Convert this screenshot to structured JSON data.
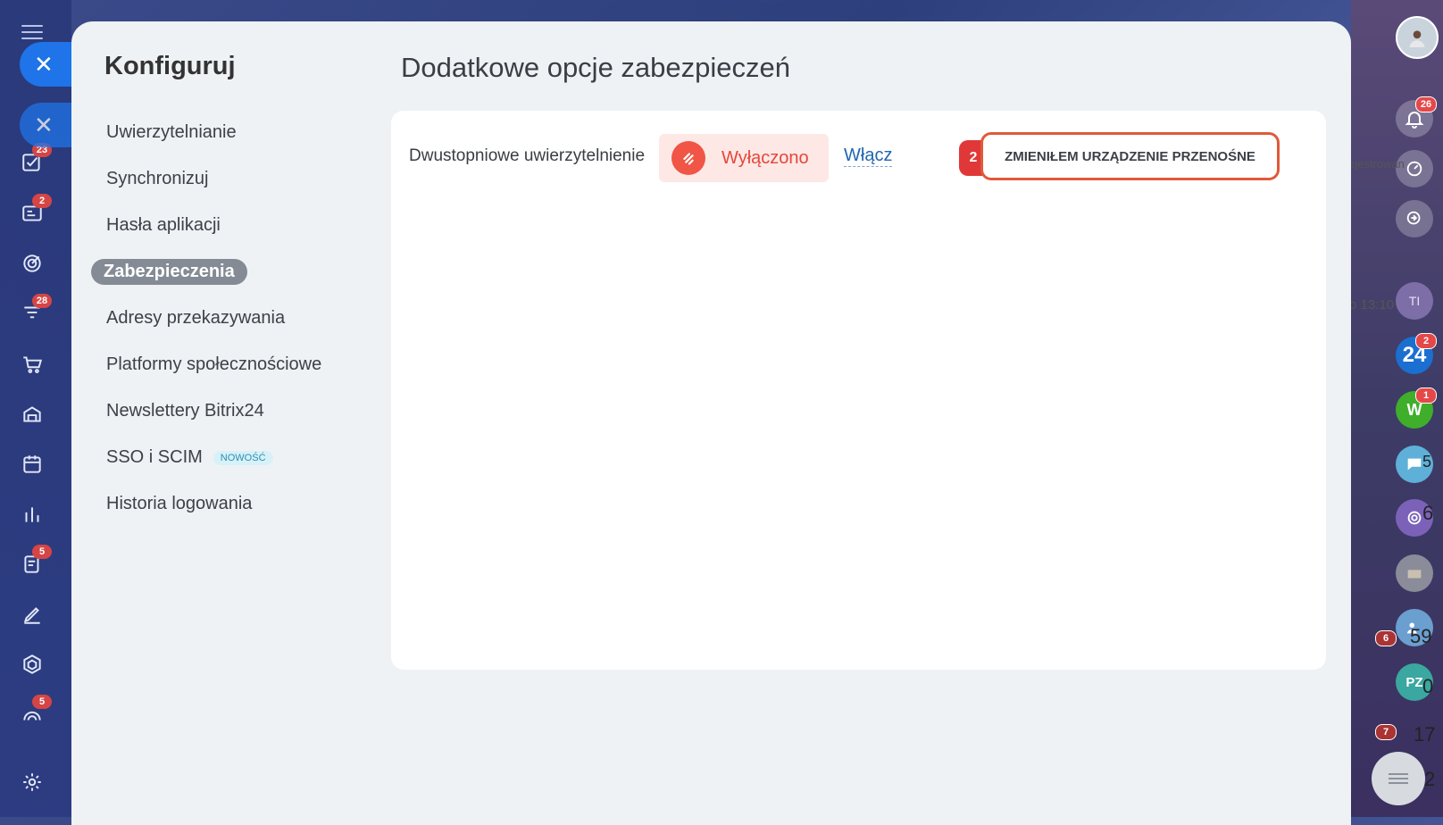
{
  "colors": {
    "accent": "#1e74e8",
    "active_nav": "#858b94",
    "danger": "#f05545",
    "highlight_border": "#e05a3a"
  },
  "left_rail": {
    "badges": [
      "23",
      "2",
      "28",
      "5",
      "5"
    ],
    "icons": [
      "menu-icon",
      "close-icon",
      "tasks-icon",
      "crm-icon",
      "target-icon",
      "funnel-icon",
      "cart-icon",
      "store-icon",
      "calendar-icon",
      "chart-icon",
      "document-icon",
      "sign-icon",
      "hexagon-icon",
      "broadcast-icon",
      "settings-icon"
    ]
  },
  "panel": {
    "title": "Konfiguruj",
    "nav": [
      {
        "label": "Uwierzytelnianie"
      },
      {
        "label": "Synchronizuj"
      },
      {
        "label": "Hasła aplikacji"
      },
      {
        "label": "Zabezpieczenia",
        "active": true
      },
      {
        "label": "Adresy przekazywania"
      },
      {
        "label": "Platformy społecznościowe"
      },
      {
        "label": "Newslettery Bitrix24"
      },
      {
        "label": "SSO i SCIM",
        "badge": "NOWOŚĆ"
      },
      {
        "label": "Historia logowania"
      }
    ]
  },
  "content": {
    "title": "Dodatkowe opcje zabezpieczeń",
    "two_factor_label": "Dwustopniowe uwierzytelnienie",
    "status": "Wyłączono",
    "enable_link": "Włącz",
    "step_number": "2",
    "changed_device_button": "ZMIENIŁEM URZĄDZENIE PRZENOŚNE"
  },
  "right_rail": {
    "notification_count": "26",
    "avatar_ti": "TI",
    "bitrix_label": "24",
    "bitrix_badge": "2",
    "w_label": "W",
    "w_badge": "1",
    "pz_label": "PZ",
    "side_text_1": "ejestrowan",
    "side_text_2": "o 13:10",
    "side_numbers": [
      "5",
      "6",
      "59",
      "0",
      "17",
      "2"
    ],
    "side_badges": [
      "6",
      "7"
    ]
  }
}
